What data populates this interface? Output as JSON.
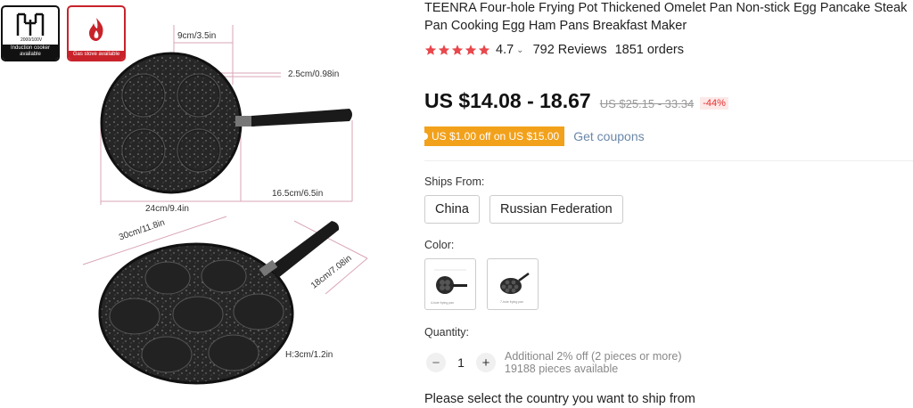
{
  "product": {
    "title": "TEENRA Four-hole Frying Pot Thickened Omelet Pan Non-stick Egg Pancake Steak Pan Cooking Egg Ham Pans Breakfast Maker",
    "rating": "4.7",
    "rating_stars": 5,
    "reviews": "792 Reviews",
    "orders": "1851 orders",
    "price": "US $14.08 - 18.67",
    "original_price": "US $25.15 - 33.34",
    "discount": "-44%",
    "coupon": "US $1.00 off on US $15.00",
    "get_coupons": "Get coupons"
  },
  "gallery": {
    "induction_badge": "Induction cooker available",
    "induction_voltage": "2000/100V",
    "gas_badge": "Gas stove available",
    "dims": {
      "top_width": "9cm/3.5in",
      "hole_depth": "2.5cm/0.98in",
      "handle_length": "16.5cm/6.5in",
      "pan_diameter": "24cm/9.4in",
      "big_diameter": "30cm/11.8in",
      "big_handle": "18cm/7.08in",
      "height": "H:3cm/1.2in"
    }
  },
  "ships_from": {
    "label": "Ships From:",
    "options": [
      "China",
      "Russian Federation"
    ]
  },
  "color": {
    "label": "Color:",
    "options": [
      "4-hole frying pan",
      "7-hole frying pan"
    ]
  },
  "quantity": {
    "label": "Quantity:",
    "minus": "−",
    "value": "1",
    "plus": "+",
    "additional": "Additional 2% off (2 pieces or more)",
    "available": "19188 pieces available"
  },
  "ship_note": "Please select the country you want to ship from",
  "colors": {
    "star": "#e8474c",
    "price": "#111111",
    "discount": "#e62e2e",
    "coupon_bg": "#f2a11b",
    "link": "#6a87a8",
    "pan": "#2b2b2b",
    "dim_line": "#d9a6b6"
  }
}
